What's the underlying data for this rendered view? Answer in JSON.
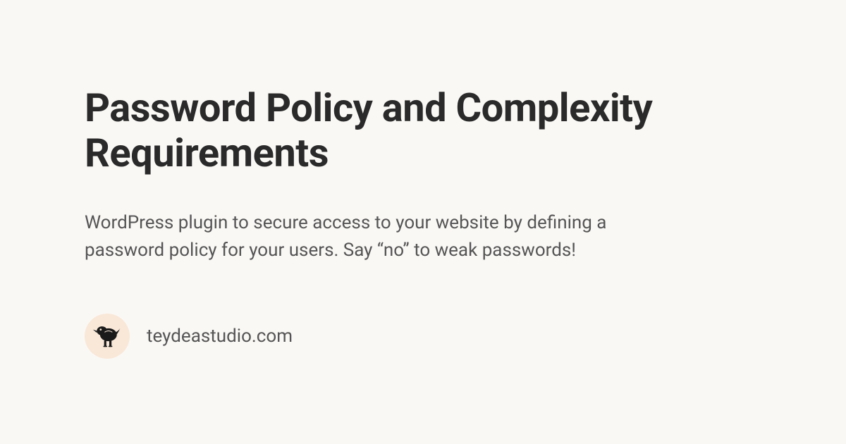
{
  "title": "Password Policy and Complexity Requirements",
  "description": "WordPress plugin to secure access to your website by defining a password policy for your users. Say “no” to weak passwords!",
  "footer": {
    "domain": "teydeastudio.com"
  }
}
